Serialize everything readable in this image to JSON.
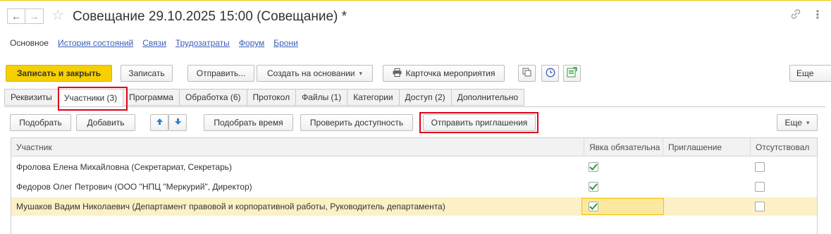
{
  "window": {
    "title": "Совещание 29.10.2025 15:00 (Совещание) *",
    "back_glyph": "←",
    "forward_glyph": "→",
    "star_glyph": "☆",
    "link_glyph": "🔗",
    "menu_glyph": "⋮"
  },
  "sections": [
    {
      "label": "Основное",
      "active": true
    },
    {
      "label": "История состояний",
      "active": false
    },
    {
      "label": "Связи",
      "active": false
    },
    {
      "label": "Трудозатраты",
      "active": false
    },
    {
      "label": "Форум",
      "active": false
    },
    {
      "label": "Брони",
      "active": false
    }
  ],
  "toolbar": {
    "save_close": "Записать и закрыть",
    "save": "Записать",
    "send": "Отправить...",
    "create_based": "Создать на основании",
    "event_card": "Карточка мероприятия",
    "more": "Еще"
  },
  "tabs": [
    {
      "label": "Реквизиты"
    },
    {
      "label": "Участники (3)",
      "active": true
    },
    {
      "label": "Программа"
    },
    {
      "label": "Обработка (6)"
    },
    {
      "label": "Протокол"
    },
    {
      "label": "Файлы (1)"
    },
    {
      "label": "Категории"
    },
    {
      "label": "Доступ (2)"
    },
    {
      "label": "Дополнительно"
    }
  ],
  "participants_bar": {
    "pick": "Подобрать",
    "add": "Добавить",
    "pick_time": "Подобрать время",
    "check_availability": "Проверить доступность",
    "send_invitations": "Отправить приглашения",
    "more": "Еще"
  },
  "table": {
    "columns": [
      "Участник",
      "Явка обязательна",
      "Приглашение",
      "Отсутствовал"
    ],
    "rows": [
      {
        "participant": "Фролова Елена Михайловна (Секретариат, Секретарь)",
        "required": true,
        "invitation": "",
        "absent": false
      },
      {
        "participant": "Федоров Олег Петрович (ООО \"НПЦ \"Меркурий\", Директор)",
        "required": true,
        "invitation": "",
        "absent": false
      },
      {
        "participant": "Мушаков Вадим Николаевич (Департамент правовой и корпоративной работы, Руководитель департамента)",
        "required": true,
        "invitation": "",
        "absent": false,
        "selected": true
      }
    ]
  },
  "colors": {
    "accent_yellow": "#f6d000",
    "highlight_red": "#e0001b",
    "link_blue": "#3a5fb6",
    "selected_row": "#fbf0c6",
    "check_green": "#2e9b3a"
  }
}
